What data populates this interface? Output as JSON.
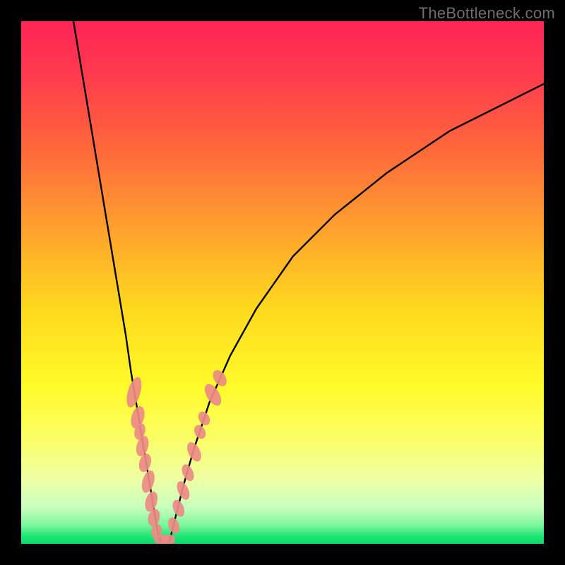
{
  "watermark": "TheBottleneck.com",
  "colors": {
    "frame": "#000000",
    "curve": "#000000",
    "marker_fill": "#ec8b85",
    "grad_stops": [
      {
        "offset": 0,
        "color": "#ff2457"
      },
      {
        "offset": 0.1,
        "color": "#ff3a4e"
      },
      {
        "offset": 0.25,
        "color": "#ff6a3a"
      },
      {
        "offset": 0.4,
        "color": "#ffa22e"
      },
      {
        "offset": 0.55,
        "color": "#ffd91e"
      },
      {
        "offset": 0.7,
        "color": "#fffb2a"
      },
      {
        "offset": 0.8,
        "color": "#fbff67"
      },
      {
        "offset": 0.88,
        "color": "#ecffa5"
      },
      {
        "offset": 0.93,
        "color": "#c9ffbe"
      },
      {
        "offset": 0.965,
        "color": "#7bf59a"
      },
      {
        "offset": 0.985,
        "color": "#1fe676"
      },
      {
        "offset": 1.0,
        "color": "#0fd969"
      }
    ]
  },
  "chart_data": {
    "type": "line",
    "title": "",
    "xlabel": "",
    "ylabel": "",
    "xlim": [
      0,
      100
    ],
    "ylim": [
      0,
      100
    ],
    "grid": false,
    "legend": false,
    "curve_left": {
      "x": [
        10,
        12,
        14,
        16,
        18,
        20,
        21,
        22,
        23,
        24,
        25,
        25.5,
        26,
        26.6
      ],
      "y": [
        100,
        88,
        76,
        64,
        52,
        40,
        33,
        27,
        21,
        15,
        9,
        6,
        3,
        0.5
      ]
    },
    "curve_right": {
      "x": [
        28.4,
        29,
        30,
        31,
        33,
        36,
        40,
        45,
        52,
        60,
        70,
        82,
        92,
        100
      ],
      "y": [
        0.5,
        3,
        7,
        11,
        18,
        27,
        36,
        45,
        55,
        63,
        71,
        79,
        84,
        88
      ]
    },
    "floor_line": {
      "x": [
        26.6,
        28.4
      ],
      "y": [
        0.5,
        0.5
      ]
    },
    "markers_left": {
      "comment": "salmon blobs along left branch",
      "points": [
        {
          "x": 21.6,
          "y": 29.0,
          "rx": 1.2,
          "ry": 3.0,
          "rot": 16
        },
        {
          "x": 22.3,
          "y": 24.2,
          "rx": 1.2,
          "ry": 2.2,
          "rot": 16
        },
        {
          "x": 22.7,
          "y": 21.5,
          "rx": 1.0,
          "ry": 1.6,
          "rot": 16
        },
        {
          "x": 23.2,
          "y": 18.7,
          "rx": 1.1,
          "ry": 2.0,
          "rot": 16
        },
        {
          "x": 23.7,
          "y": 15.5,
          "rx": 1.1,
          "ry": 1.8,
          "rot": 16
        },
        {
          "x": 24.3,
          "y": 11.9,
          "rx": 1.1,
          "ry": 2.2,
          "rot": 16
        },
        {
          "x": 24.9,
          "y": 8.1,
          "rx": 1.1,
          "ry": 2.0,
          "rot": 16
        },
        {
          "x": 25.4,
          "y": 5.0,
          "rx": 1.1,
          "ry": 1.7,
          "rot": 14
        },
        {
          "x": 25.9,
          "y": 2.4,
          "rx": 1.0,
          "ry": 1.4,
          "rot": 12
        },
        {
          "x": 26.7,
          "y": 0.8,
          "rx": 1.3,
          "ry": 1.0,
          "rot": 0
        }
      ]
    },
    "markers_right": {
      "comment": "salmon blobs along right branch",
      "points": [
        {
          "x": 28.2,
          "y": 0.8,
          "rx": 1.3,
          "ry": 1.0,
          "rot": 0
        },
        {
          "x": 29.2,
          "y": 3.5,
          "rx": 1.0,
          "ry": 1.6,
          "rot": -20
        },
        {
          "x": 30.1,
          "y": 6.8,
          "rx": 1.0,
          "ry": 1.7,
          "rot": -22
        },
        {
          "x": 31.0,
          "y": 10.2,
          "rx": 1.0,
          "ry": 1.9,
          "rot": -24
        },
        {
          "x": 31.9,
          "y": 13.6,
          "rx": 1.0,
          "ry": 1.7,
          "rot": -25
        },
        {
          "x": 33.1,
          "y": 17.6,
          "rx": 1.1,
          "ry": 2.0,
          "rot": -27
        },
        {
          "x": 34.2,
          "y": 21.4,
          "rx": 1.0,
          "ry": 1.4,
          "rot": -28
        },
        {
          "x": 35.0,
          "y": 24.0,
          "rx": 1.0,
          "ry": 1.4,
          "rot": -30
        },
        {
          "x": 36.7,
          "y": 28.5,
          "rx": 1.2,
          "ry": 2.3,
          "rot": -31
        },
        {
          "x": 38.0,
          "y": 31.7,
          "rx": 1.1,
          "ry": 1.7,
          "rot": -33
        }
      ]
    }
  }
}
